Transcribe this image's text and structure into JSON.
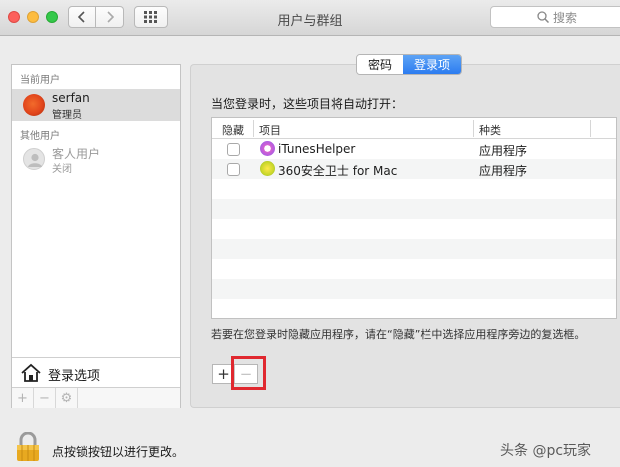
{
  "window": {
    "title": "用户与群组",
    "search_placeholder": "搜索"
  },
  "sidebar": {
    "current_users_header": "当前用户",
    "other_users_header": "其他用户",
    "current_user": {
      "name": "serfan",
      "role": "管理员"
    },
    "guest_user": {
      "name": "客人用户",
      "status": "关闭"
    },
    "login_options_label": "登录选项",
    "tools": [
      "+",
      "−",
      "⚙"
    ]
  },
  "tabs": [
    {
      "label": "密码",
      "active": false
    },
    {
      "label": "登录项",
      "active": true
    }
  ],
  "login_items": {
    "intro": "当您登录时，这些项目将自动打开：",
    "columns": {
      "hide": "隐藏",
      "item": "项目",
      "kind": "种类"
    },
    "rows": [
      {
        "name": "iTunesHelper",
        "kind": "应用程序",
        "hidden": false,
        "icon": "itunes-icon"
      },
      {
        "name": "360安全卫士 for Mac",
        "kind": "应用程序",
        "hidden": false,
        "icon": "360-security-icon"
      }
    ],
    "hint": "若要在您登录时隐藏应用程序，请在“隐藏”栏中选择应用程序旁边的复选框。",
    "add_label": "+",
    "remove_label": "−"
  },
  "footer": {
    "lock_text": "点按锁按钮以进行更改。"
  },
  "watermark": "头条 @pc玩家",
  "colors": {
    "accent": "#2c7cf0",
    "highlight_box": "#e0282f"
  }
}
